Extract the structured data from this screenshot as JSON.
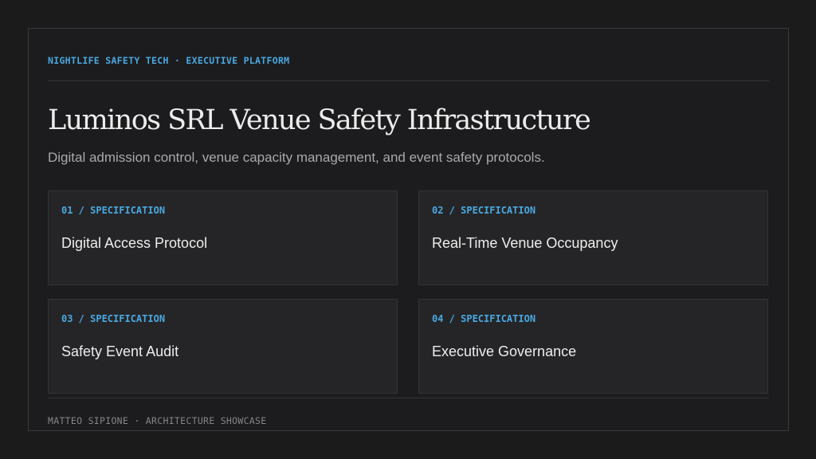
{
  "header": {
    "kicker": "NIGHTLIFE SAFETY TECH · EXECUTIVE PLATFORM",
    "title": "Luminos SRL Venue Safety Infrastructure",
    "subtitle": "Digital admission control, venue capacity management, and event safety protocols."
  },
  "cards": [
    {
      "label": "01 / SPECIFICATION",
      "title": "Digital Access Protocol"
    },
    {
      "label": "02 / SPECIFICATION",
      "title": "Real-Time Venue Occupancy"
    },
    {
      "label": "03 / SPECIFICATION",
      "title": "Safety Event Audit"
    },
    {
      "label": "04 / SPECIFICATION",
      "title": "Executive Governance"
    }
  ],
  "footer": {
    "text": "MATTEO SIPIONE · ARCHITECTURE SHOWCASE"
  },
  "colors": {
    "background": "#1b1b1c",
    "card_background": "#252527",
    "accent": "#4aa8e0",
    "title_text": "#ececec",
    "muted_text": "#a9a9ad"
  }
}
